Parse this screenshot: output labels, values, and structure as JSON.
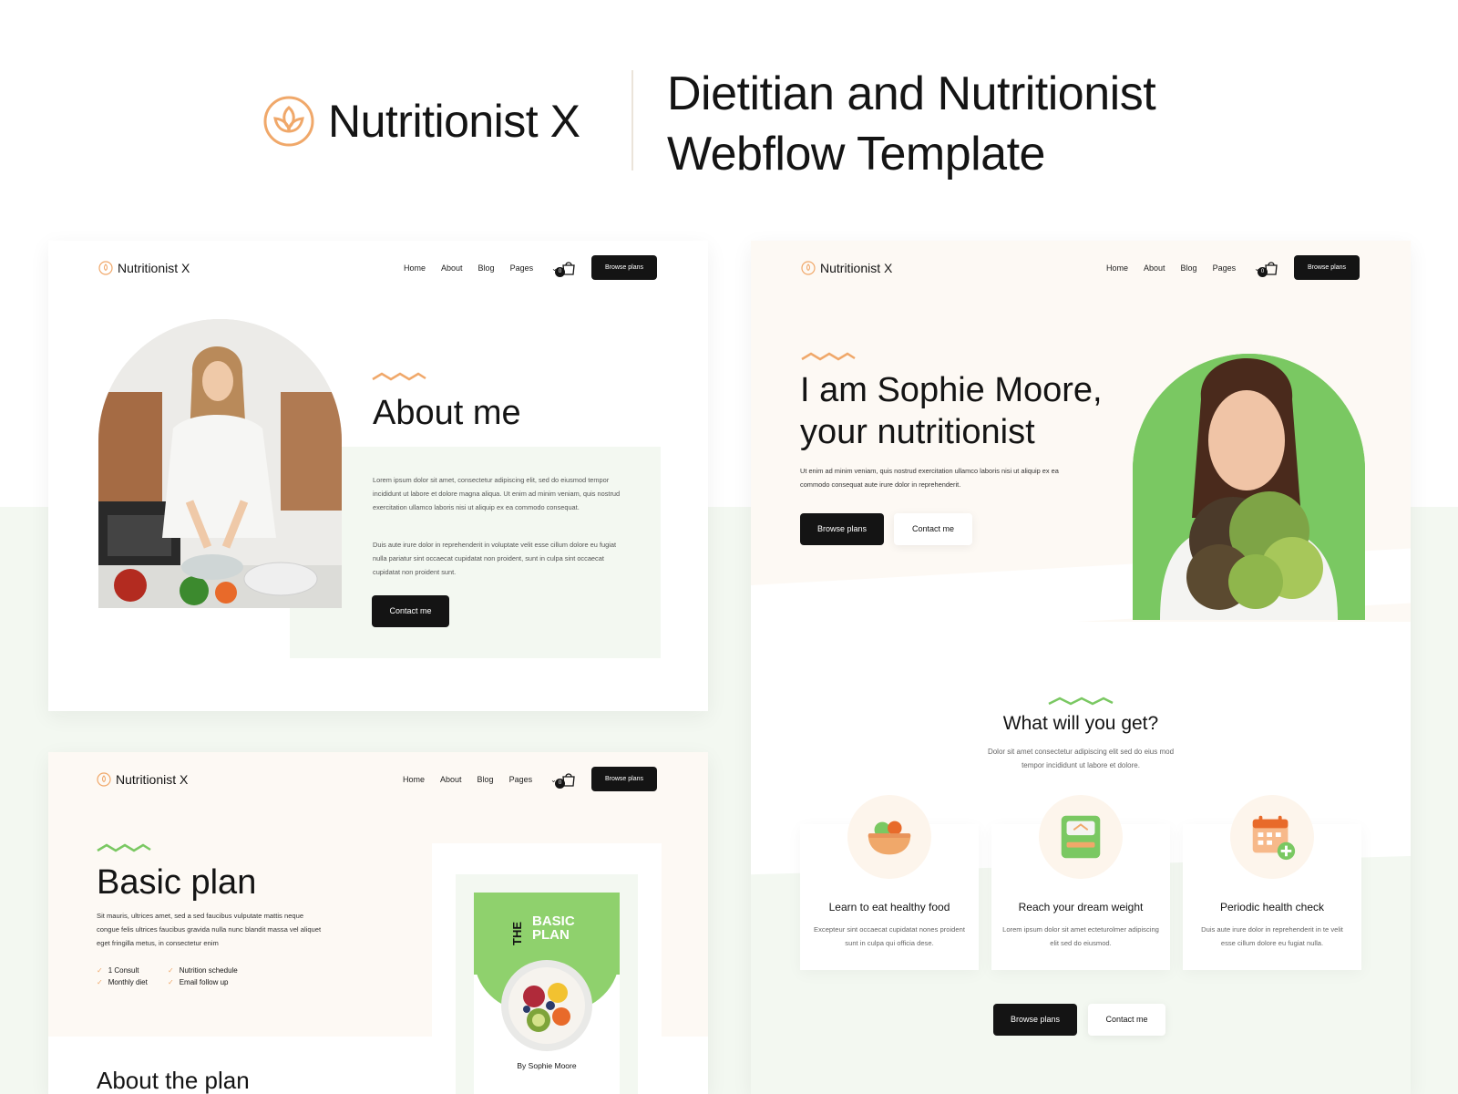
{
  "hero": {
    "brand": "Nutritionist X",
    "title_line1": "Dietitian and Nutritionist",
    "title_line2": "Webflow Template"
  },
  "nav": {
    "brand": "Nutritionist X",
    "links": [
      "Home",
      "About",
      "Blog",
      "Pages"
    ],
    "cart_count": "0",
    "browse_label": "Browse plans"
  },
  "about": {
    "title": "About me",
    "para1": "Lorem ipsum dolor sit amet, consectetur adipiscing elit, sed do eiusmod tempor incididunt ut labore et dolore magna aliqua. Ut enim ad minim veniam, quis nostrud exercitation ullamco laboris nisi ut aliquip ex ea commodo consequat.",
    "para2": "Duis aute irure dolor in reprehenderit in voluptate velit esse cillum dolore eu fugiat nulla pariatur sint occaecat cupidatat non proident, sunt in culpa sint occaecat cupidatat non proident sunt.",
    "contact_label": "Contact me"
  },
  "home": {
    "title_line1": "I am Sophie Moore,",
    "title_line2": "your nutritionist",
    "subtitle": "Ut enim ad minim veniam, quis nostrud exercitation ullamco laboris nisi ut aliquip ex ea commodo consequat aute irure dolor in reprehenderit.",
    "browse_label": "Browse plans",
    "contact_label": "Contact me",
    "section_title": "What will you get?",
    "section_sub": "Dolor sit amet consectetur adipiscing elit sed do eius mod tempor incididunt ut labore et dolore.",
    "features": [
      {
        "title": "Learn to eat healthy food",
        "desc": "Excepteur sint occaecat cupidatat nones proident sunt in culpa qui officia dese.",
        "icon": "food-bowl-icon"
      },
      {
        "title": "Reach your dream weight",
        "desc": "Lorem ipsum dolor sit amet ecteturolmer adipiscing elit sed do eiusmod.",
        "icon": "scale-icon"
      },
      {
        "title": "Periodic health check",
        "desc": "Duis aute irure dolor in reprehenderit in te velit esse cillum dolore eu fugiat nulla.",
        "icon": "calendar-icon"
      }
    ],
    "bottom_browse_label": "Browse plans",
    "bottom_contact_label": "Contact me"
  },
  "plan": {
    "title": "Basic plan",
    "desc": "Sit mauris, ultrices amet, sed a sed faucibus vulputate mattis neque congue felis ultrices faucibus gravida nulla nunc blandit massa vel aliquet eget fringilla metus, in consectetur enim",
    "checks": [
      "1 Consult",
      "Nutrition schedule",
      "Monthly diet",
      "Email follow up"
    ],
    "cover_the": "THE",
    "cover_name": "BASIC PLAN",
    "cover_by": "By Sophie Moore",
    "next_heading": "About the plan"
  },
  "colors": {
    "accent_orange": "#f0a86a",
    "accent_green": "#7ac862",
    "dark": "#141414",
    "peach_bg": "#fdf9f4",
    "mint_bg": "#f3f8f1"
  }
}
